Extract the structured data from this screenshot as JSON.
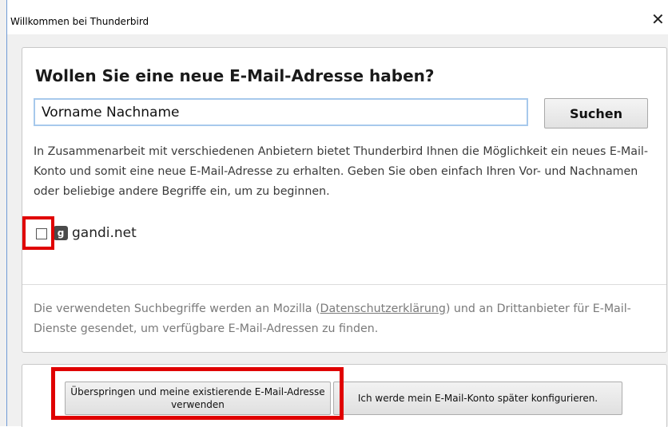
{
  "window": {
    "title": "Willkommen bei Thunderbird",
    "close_symbol": "✕"
  },
  "main": {
    "heading": "Wollen Sie eine neue E-Mail-Adresse haben?",
    "search_value": "Vorname Nachname",
    "search_button": "Suchen",
    "info": "In Zusammenarbeit mit verschiedenen Anbietern bietet Thunderbird Ihnen die Möglichkeit ein neues E-Mail-Konto und somit eine neue E-Mail-Adresse zu erhalten. Geben Sie oben einfach Ihren Vor- und Nachnamen oder beliebige andere Begriffe ein, um zu beginnen.",
    "providers": [
      {
        "name": "gandi.net",
        "icon": "gandi-logo-icon",
        "logo_glyph": "g",
        "checked": false
      }
    ],
    "privacy_prefix": "Die verwendeten Suchbegriffe werden an Mozilla (",
    "privacy_link": "Datenschutzerklärung",
    "privacy_suffix": ") und an Drittanbieter für E-Mail-Dienste gesendet, um verfügbare E-Mail-Adressen zu finden."
  },
  "footer": {
    "skip_button": "Überspringen und meine existierende E-Mail-Adresse verwenden",
    "later_button": "Ich werde mein E-Mail-Konto später konfigurieren."
  },
  "highlights": {
    "color": "#e00000"
  }
}
